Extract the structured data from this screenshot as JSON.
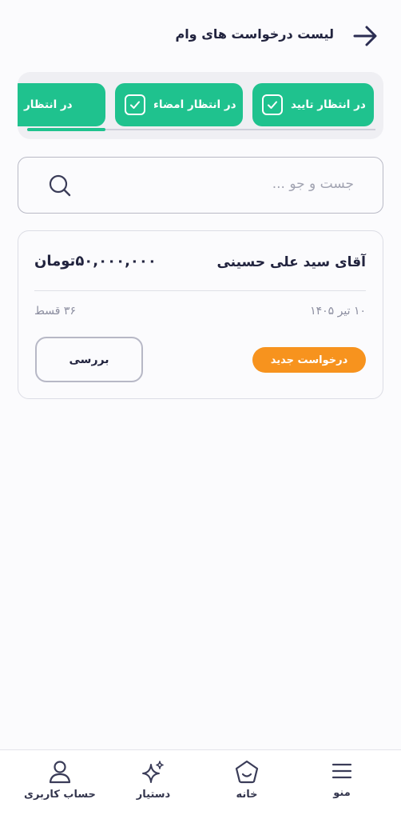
{
  "header": {
    "title": "لیست درخواست های وام",
    "back_icon": "arrow-right-icon"
  },
  "filters": {
    "chips": [
      {
        "label": "در انتظار تایید",
        "icon": "checkbox-icon",
        "selected": true
      },
      {
        "label": "در انتظار امضاء",
        "icon": "checkbox-icon",
        "selected": true
      },
      {
        "label": "در انتظار",
        "icon": "checkbox-icon",
        "selected": true
      }
    ],
    "accent_color": "#1fc28e"
  },
  "search": {
    "placeholder": "جست و جو ...",
    "icon": "search-icon"
  },
  "loan_card": {
    "name": "آقای سید علی حسینی",
    "amount": "۵۰,۰۰۰,۰۰۰تومان",
    "date": "۱۰ تیر ۱۴۰۵",
    "installments": "۳۶ قسط",
    "status": "درخواست جدید",
    "status_color": "#f7931e",
    "action_label": "بررسی"
  },
  "bottom_nav": {
    "menu_label": "منو",
    "home_label": "خانه",
    "assistant_label": "دستیار",
    "account_label": "حساب کاربری",
    "icons": [
      "menu-icon",
      "home-icon",
      "sparkle-icon",
      "user-icon"
    ]
  }
}
